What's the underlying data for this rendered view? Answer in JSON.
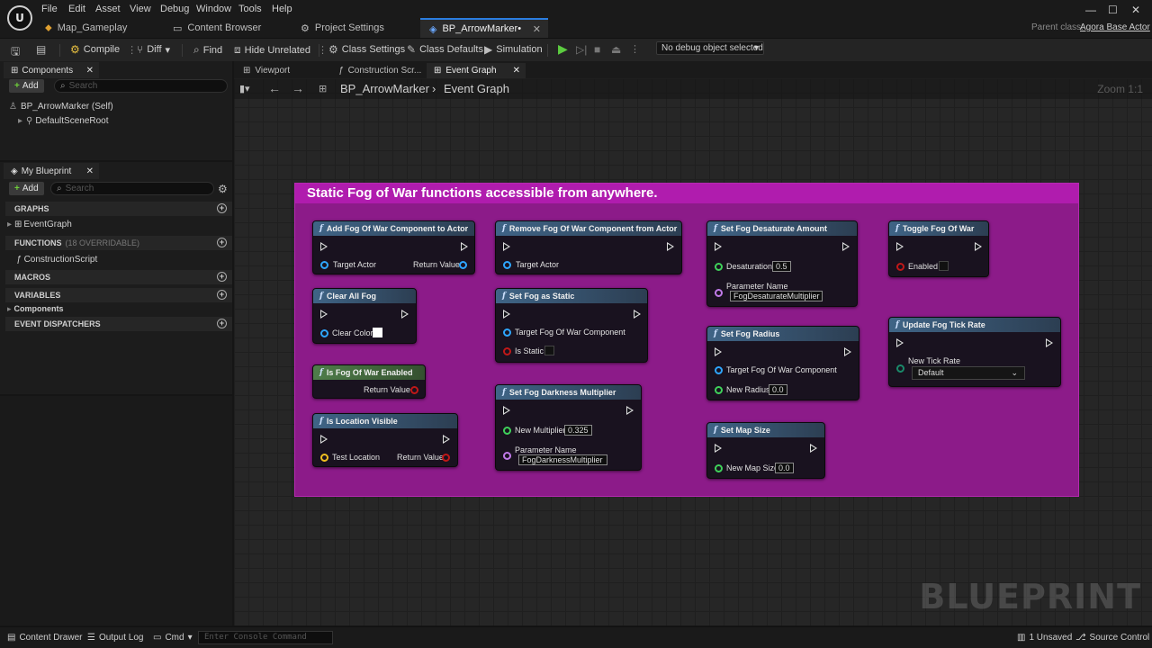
{
  "menu": [
    "File",
    "Edit",
    "Asset",
    "View",
    "Debug",
    "Window",
    "Tools",
    "Help"
  ],
  "doc_tabs": [
    "Map_Gameplay",
    "Content Browser",
    "Project Settings",
    "BP_ArrowMarker•"
  ],
  "parent_class": {
    "label": "Parent class:",
    "value": "Agora Base Actor"
  },
  "toolbar": {
    "compile": "Compile",
    "diff": "Diff",
    "find": "Find",
    "hide_unrelated": "Hide Unrelated",
    "class_settings": "Class Settings",
    "class_defaults": "Class Defaults",
    "simulation": "Simulation",
    "debug_object": "No debug object selected"
  },
  "components_panel": {
    "tab": "Components",
    "add": "Add",
    "search_placeholder": "Search",
    "self": "BP_ArrowMarker (Self)",
    "root": "DefaultSceneRoot"
  },
  "my_blueprint": {
    "tab": "My Blueprint",
    "add": "Add",
    "search_placeholder": "Search",
    "graphs": "GRAPHS",
    "event_graph": "EventGraph",
    "functions": "FUNCTIONS",
    "functions_count": "(18 OVERRIDABLE)",
    "construction_script": "ConstructionScript",
    "macros": "MACROS",
    "variables": "VARIABLES",
    "components": "Components",
    "event_dispatchers": "EVENT DISPATCHERS"
  },
  "graph_tabs": [
    "Viewport",
    "Construction Scr...",
    "Event Graph"
  ],
  "breadcrumb": {
    "blueprint": "BP_ArrowMarker",
    "graph": "Event Graph"
  },
  "zoom": "Zoom 1:1",
  "watermark": "BLUEPRINT",
  "comment": {
    "title": "Static Fog of War functions accessible from anywhere.",
    "color": "#8c1b89"
  },
  "nodes": {
    "add_fog": {
      "title": "Add Fog Of War Component to Actor",
      "in": "Target Actor",
      "out": "Return Value"
    },
    "remove_fog": {
      "title": "Remove Fog Of War Component from Actor",
      "in": "Target Actor"
    },
    "set_desat": {
      "title": "Set Fog Desaturate Amount",
      "p1": "Desaturation",
      "v1": "0.5",
      "p2": "Parameter Name",
      "v2": "FogDesaturateMultiplier"
    },
    "toggle": {
      "title": "Toggle Fog Of War",
      "p1": "Enabled"
    },
    "clear_all": {
      "title": "Clear All Fog",
      "p1": "Clear Color"
    },
    "set_static": {
      "title": "Set Fog as Static",
      "p1": "Target Fog Of War Component",
      "p2": "Is Static"
    },
    "set_radius": {
      "title": "Set Fog Radius",
      "p1": "Target Fog Of War Component",
      "p2": "New Radius",
      "v2": "0.0"
    },
    "update_tick": {
      "title": "Update Fog Tick Rate",
      "p1": "New Tick Rate",
      "v1": "Default"
    },
    "is_enabled": {
      "title": "Is Fog Of War Enabled",
      "out": "Return Value"
    },
    "set_dark": {
      "title": "Set Fog Darkness Multiplier",
      "p1": "New Multiplier",
      "v1": "0.325",
      "p2": "Parameter Name",
      "v2": "FogDarknessMultiplier"
    },
    "is_visible": {
      "title": "Is Location Visible",
      "in": "Test Location",
      "out": "Return Value"
    },
    "set_map": {
      "title": "Set Map Size",
      "p1": "New Map Size",
      "v1": "0.0"
    }
  },
  "statusbar": {
    "content_drawer": "Content Drawer",
    "output_log": "Output Log",
    "cmd": "Cmd",
    "console_placeholder": "Enter Console Command",
    "unsaved": "1 Unsaved",
    "source_control": "Source Control"
  }
}
